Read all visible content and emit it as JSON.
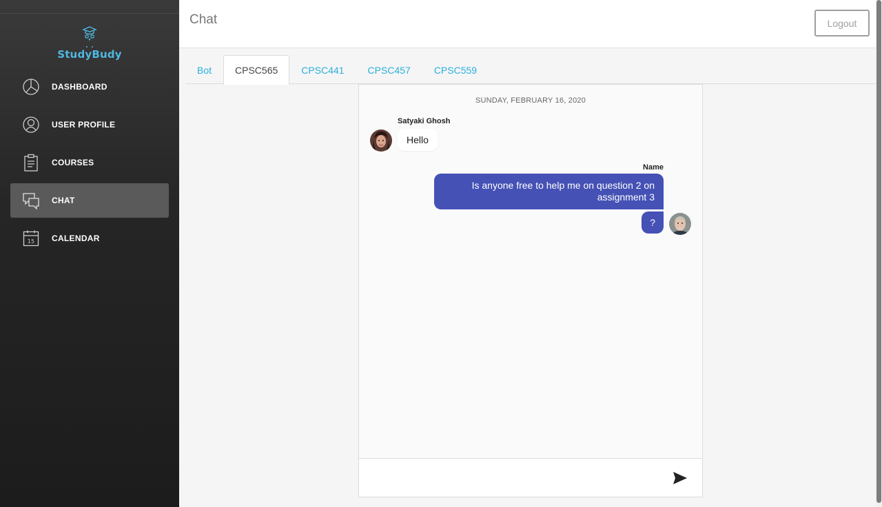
{
  "brand": {
    "name": "StudyBudy",
    "color": "#4fb8e0"
  },
  "sidebar": {
    "items": [
      {
        "label": "DASHBOARD",
        "icon": "pie-chart-icon",
        "active": false
      },
      {
        "label": "USER PROFILE",
        "icon": "user-icon",
        "active": false
      },
      {
        "label": "COURSES",
        "icon": "clipboard-icon",
        "active": false
      },
      {
        "label": "CHAT",
        "icon": "chat-bubbles-icon",
        "active": true
      },
      {
        "label": "CALENDAR",
        "icon": "calendar-icon",
        "active": false,
        "icon_text": "15"
      }
    ]
  },
  "header": {
    "title": "Chat",
    "logout_label": "Logout"
  },
  "tabs": [
    {
      "label": "Bot",
      "active": false
    },
    {
      "label": "CPSC565",
      "active": true
    },
    {
      "label": "CPSC441",
      "active": false
    },
    {
      "label": "CPSC457",
      "active": false
    },
    {
      "label": "CPSC559",
      "active": false
    }
  ],
  "chat": {
    "date": "SUNDAY, FEBRUARY 16, 2020",
    "messages": [
      {
        "sender": "Satyaki Ghosh",
        "text": "Hello",
        "side": "left"
      },
      {
        "sender": "Name",
        "text": "Is anyone free to help me on question 2 on assignment 3",
        "side": "right"
      },
      {
        "sender": "",
        "text": "?",
        "side": "right"
      }
    ],
    "composer_placeholder": ""
  },
  "colors": {
    "accent": "#4551b5",
    "tab_link": "#2aaedb",
    "sidebar_bg": "#262626"
  }
}
